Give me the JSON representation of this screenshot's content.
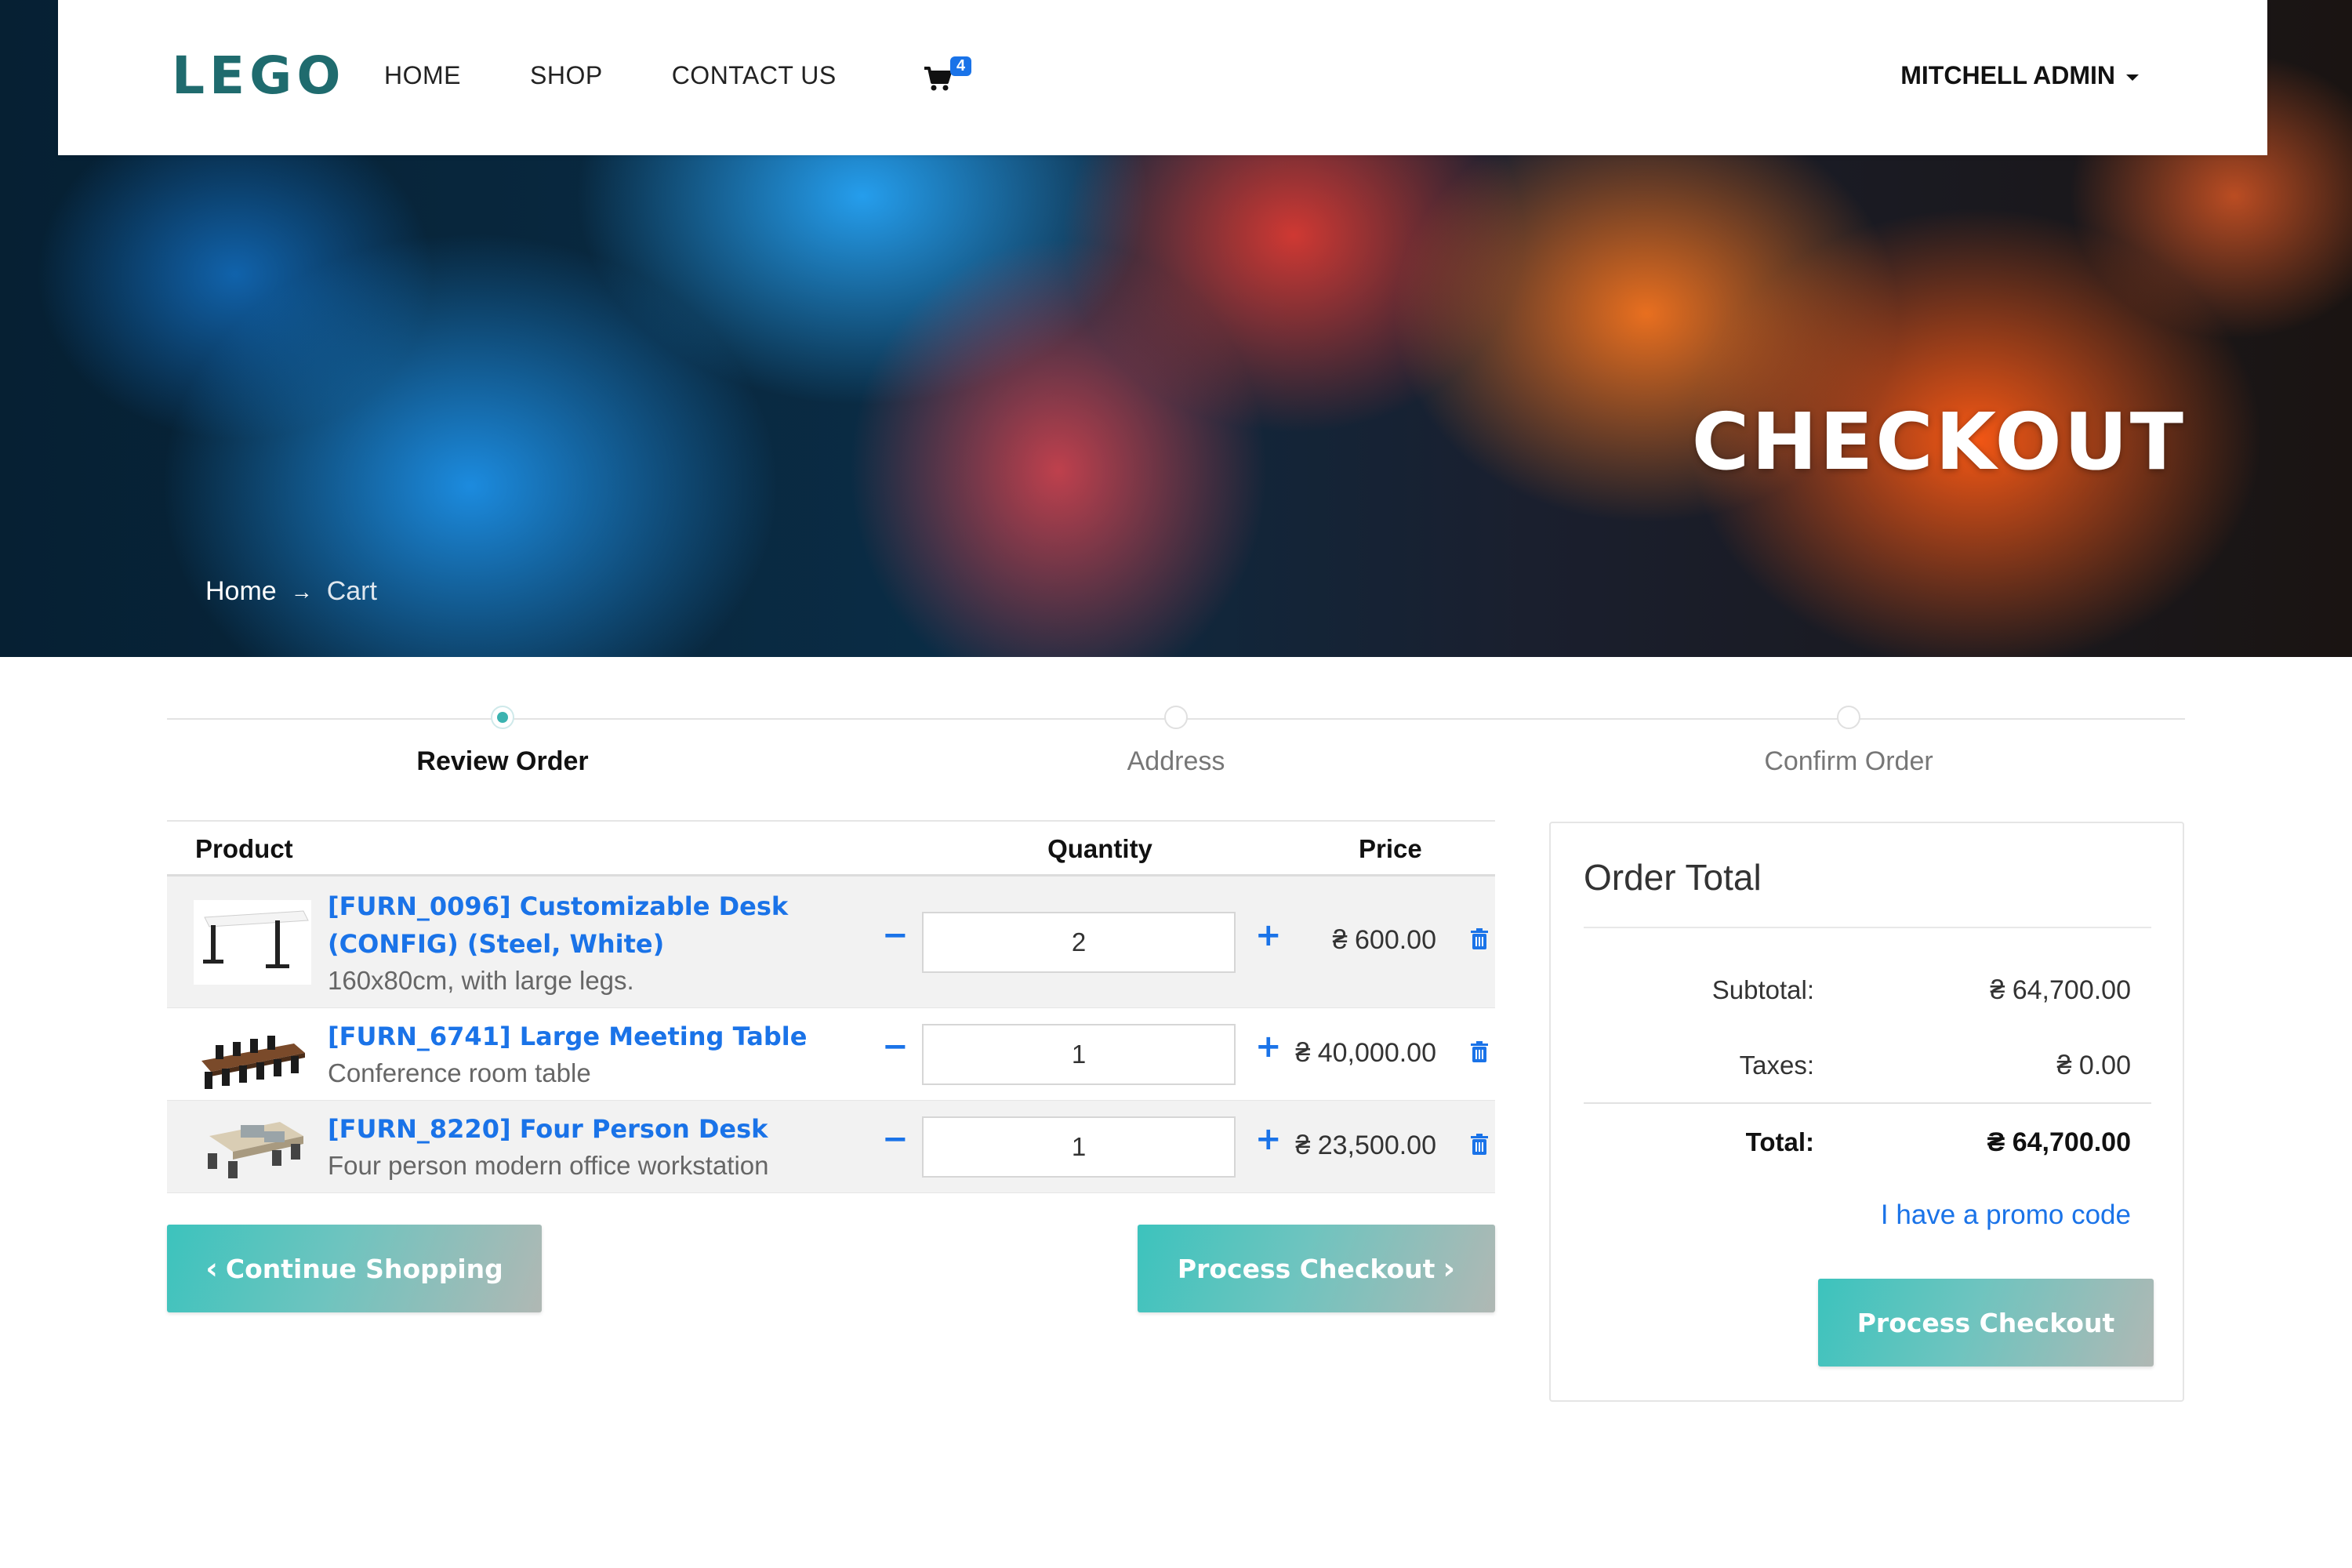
{
  "navbar": {
    "brand": "LEGO",
    "links": [
      "HOME",
      "SHOP",
      "CONTACT US"
    ],
    "cart_count": "4",
    "user_name": "MITCHELL ADMIN"
  },
  "hero": {
    "title": "CHECKOUT",
    "breadcrumb": {
      "home": "Home",
      "current": "Cart"
    }
  },
  "wizard": {
    "steps": [
      {
        "label": "Review Order",
        "active": true
      },
      {
        "label": "Address",
        "active": false
      },
      {
        "label": "Confirm Order",
        "active": false
      }
    ]
  },
  "cart": {
    "headers": {
      "product": "Product",
      "quantity": "Quantity",
      "price": "Price"
    },
    "items": [
      {
        "name_line1": "[FURN_0096] Customizable Desk",
        "name_line2": "(CONFIG) (Steel, White)",
        "description": "160x80cm, with large legs.",
        "quantity": "2",
        "price": "₴ 600.00"
      },
      {
        "name_line1": "[FURN_6741] Large Meeting Table",
        "description": "Conference room table",
        "quantity": "1",
        "price": "₴ 40,000.00"
      },
      {
        "name_line1": "[FURN_8220] Four Person Desk",
        "description": "Four person modern office workstation",
        "quantity": "1",
        "price": "₴ 23,500.00"
      }
    ],
    "continue_label": "Continue Shopping",
    "checkout_label": "Process Checkout"
  },
  "order_total": {
    "title": "Order Total",
    "subtotal_label": "Subtotal:",
    "subtotal_value": "₴ 64,700.00",
    "taxes_label": "Taxes:",
    "taxes_value": "₴ 0.00",
    "total_label": "Total:",
    "total_value": "₴ 64,700.00",
    "promo_label": "I have a promo code",
    "checkout_label": "Process Checkout"
  },
  "colors": {
    "brand": "#1f6b6e",
    "link": "#1a73e8",
    "accent": "#3bb3b0"
  }
}
